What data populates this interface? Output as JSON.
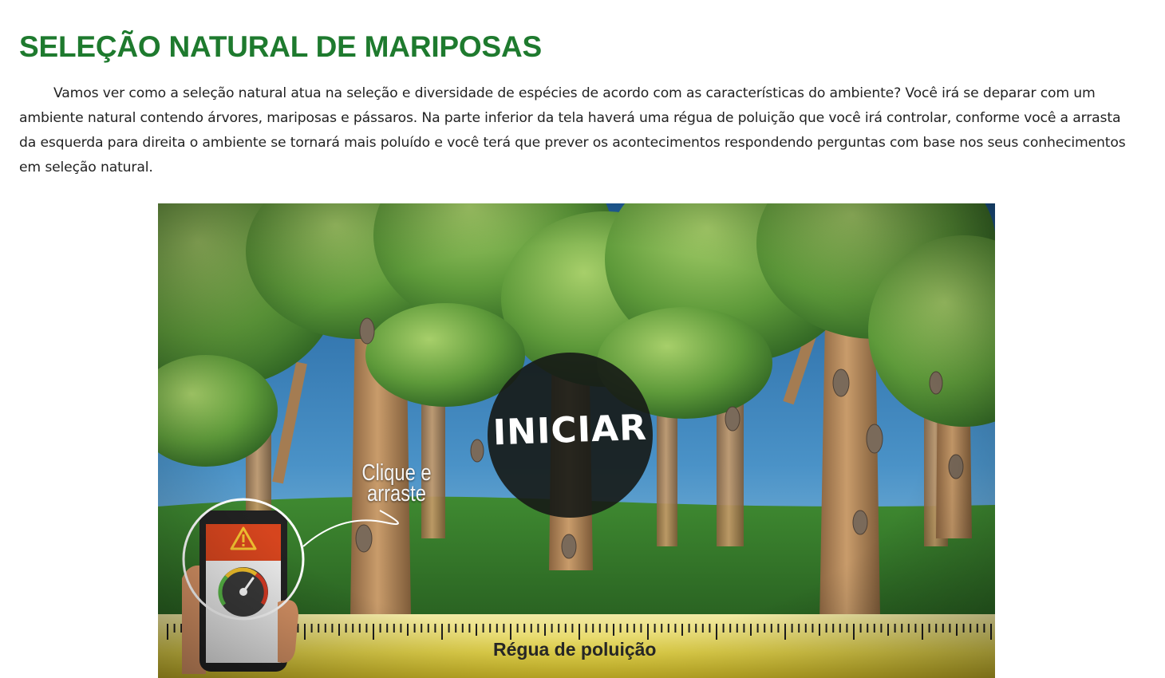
{
  "page": {
    "title": "SELEÇÃO NATURAL DE MARIPOSAS",
    "intro": "Vamos ver como a seleção natural atua na seleção e diversidade de espécies de acordo com as características do ambiente? Você irá se deparar com um ambiente natural contendo árvores, mariposas e pássaros. Na parte inferior da tela haverá uma régua de poluição que você irá controlar, conforme você a arrasta da esquerda para direita o ambiente se tornará mais poluído e você terá que prever os acontecimentos respondendo perguntas com base nos seus conhecimentos em seleção natural."
  },
  "simulation": {
    "start_label": "INICIAR",
    "hint_line1": "Clique e",
    "hint_line2": "arraste",
    "ruler_label": "Régua de poluição",
    "pollution_level": 0,
    "colors": {
      "title_green": "#1e7a2e",
      "sky": "#3f86be",
      "grass": "#2f6b27",
      "trunk": "#b58a5c",
      "ruler": "#e4d64f",
      "alert": "#d6451e"
    },
    "icons": [
      "warning-icon",
      "gauge-icon",
      "moth-icon",
      "hand-icon"
    ]
  }
}
